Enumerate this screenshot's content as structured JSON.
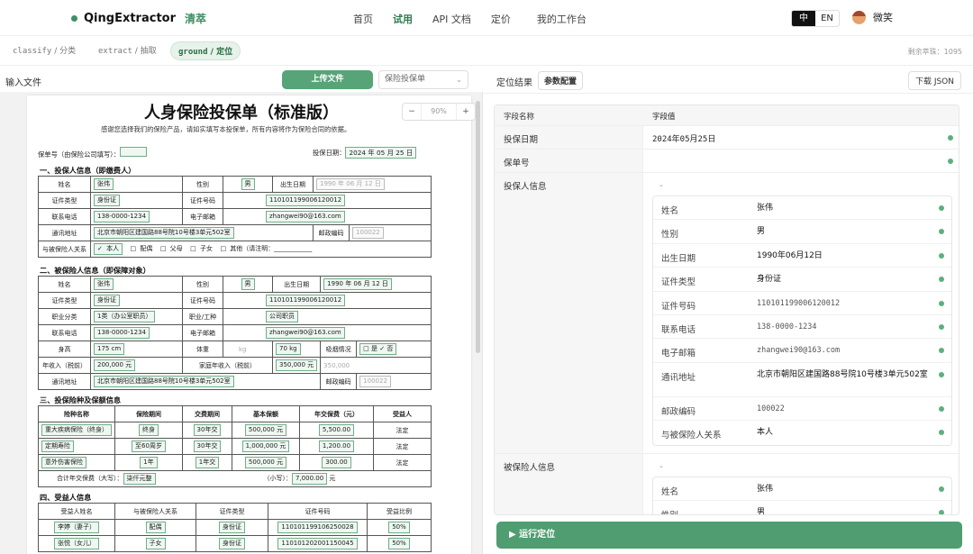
{
  "brand": {
    "name": "QingExtractor",
    "name_cn": "清萃"
  },
  "nav": {
    "items": [
      "首页",
      "试用",
      "API 文档",
      "定价"
    ],
    "workspace": "我的工作台"
  },
  "lang": {
    "zh": "中",
    "en": "EN"
  },
  "user": {
    "name": "微笑"
  },
  "modes": {
    "classify": "classify",
    "classify_cn": " / 分类",
    "extract": "extract",
    "extract_cn": " / 抽取",
    "ground": "ground",
    "ground_cn": " / 定位",
    "remaining": "剩余萃珠：1095"
  },
  "left": {
    "title": "输入文件",
    "upload": "上传文件",
    "select": "保险投保单",
    "zoom": "90%",
    "minus": "−",
    "plus": "+"
  },
  "form": {
    "title": "人身保险投保单（标准版）",
    "subtitle": "感谢您选择我们的保险产品，请如实填写本投保单，所有内容将作为保险合同的依据。",
    "policy_no_label": "保单号（由保险公司填写）：",
    "date_label": "投保日期：",
    "date_value": "2024 年 05 月 25 日",
    "s1": "一、投保人信息（即缴费人）",
    "s1_rows": {
      "name_l": "姓名",
      "name_v": "张伟",
      "sex_l": "性别",
      "sex_v": "男",
      "birth_l": "出生日期",
      "birth_v": "1990 年 06 月 12 日",
      "idt_l": "证件类型",
      "idt_v": "身份证",
      "idn_l": "证件号码",
      "idn_v": "110101199006120012",
      "tel_l": "联系电话",
      "tel_v": "138-0000-1234",
      "mail_l": "电子邮箱",
      "mail_v": "zhangwei90@163.com",
      "addr_l": "通讯地址",
      "addr_v": "北京市朝阳区建国路88号院10号楼3单元502室",
      "zip_l": "邮政编码",
      "zip_v": "100022",
      "rel_l": "与被保险人关系",
      "rel_opts": [
        "✓ 本人",
        "□ 配偶",
        "□ 父母",
        "□ 子女",
        "□ 其他（请注明：____________"
      ]
    },
    "s2": "二、被保险人信息（即保障对象）",
    "s2_rows": {
      "job_l": "职业分类",
      "job_v": "1类（办公室职员）",
      "jobt_l": "职业/工种",
      "jobt_v": "公司职员",
      "h_l": "身高",
      "h_v": "175 cm",
      "w_l": "体重",
      "w_v": "70 kg",
      "kg": "kg",
      "smoke_l": "吸烟情况",
      "smoke_v": "□ 是  ✓ 否",
      "inc_l": "年收入（税前）",
      "inc_v": "200,000 元",
      "finc_l": "家庭年收入（税前）",
      "finc_v": "350,000 元",
      "finc_v2": "350,000"
    },
    "s3": "三、投保险种及保额信息",
    "s3_head": [
      "险种名称",
      "保险期间",
      "交费期间",
      "基本保额",
      "年交保费（元）",
      "受益人"
    ],
    "s3_rows": [
      [
        "重大疾病保险（终身）",
        "终身",
        "30年交",
        "500,000 元",
        "5,500.00",
        "法定"
      ],
      [
        "定期寿险",
        "至60周岁",
        "30年交",
        "1,000,000 元",
        "1,200.00",
        "法定"
      ],
      [
        "意外伤害保险",
        "1年",
        "1年交",
        "500,000 元",
        "300.00",
        "法定"
      ]
    ],
    "total_l": "合计年交保费（大写）：",
    "total_cn": "柒仟元整",
    "total_s": "（小写）：",
    "total_v": "7,000.00",
    "total_unit": "元",
    "s4": "四、受益人信息",
    "s4_head": [
      "受益人姓名",
      "与被保险人关系",
      "证件类型",
      "证件号码",
      "受益比例"
    ],
    "s4_rows": [
      [
        "李婷（妻子）",
        "配偶",
        "身份证",
        "110101199106250028",
        "50%"
      ],
      [
        "张悦（女儿）",
        "子女",
        "身份证",
        "110101202001150045",
        "50%"
      ]
    ]
  },
  "right": {
    "title": "定位结果",
    "config": "参数配置",
    "download": "下载 JSON",
    "col_key": "字段名称",
    "col_val": "字段值",
    "date_k": "投保日期",
    "date_v": "2024年05月25日",
    "policy_k": "保单号",
    "holder_k": "投保人信息",
    "insured_k": "被保险人信息",
    "holder": [
      {
        "k": "姓名",
        "v": "张伟"
      },
      {
        "k": "性别",
        "v": "男"
      },
      {
        "k": "出生日期",
        "v": "1990年06月12日"
      },
      {
        "k": "证件类型",
        "v": "身份证"
      },
      {
        "k": "证件号码",
        "v": "110101199006120012"
      },
      {
        "k": "联系电话",
        "v": "138-0000-1234"
      },
      {
        "k": "电子邮箱",
        "v": "zhangwei90@163.com"
      },
      {
        "k": "通讯地址",
        "v": "北京市朝阳区建国路88号院10号楼3单元502室"
      },
      {
        "k": "邮政编码",
        "v": "100022"
      },
      {
        "k": "与被保险人关系",
        "v": "本人"
      }
    ],
    "insured": [
      {
        "k": "姓名",
        "v": "张伟"
      },
      {
        "k": "性别",
        "v": "男"
      }
    ],
    "run": "▶ 运行定位"
  },
  "colors": {
    "accent": "#4f9d70",
    "status": "#5cb07e"
  }
}
